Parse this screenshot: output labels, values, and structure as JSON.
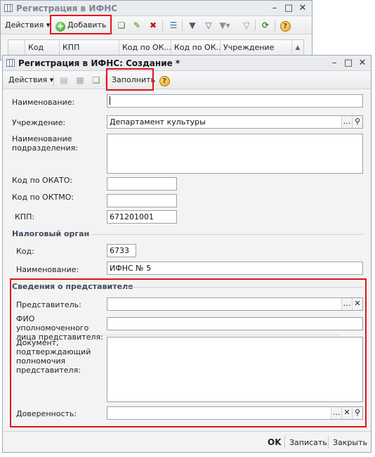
{
  "back_window": {
    "title": "Регистрация в ИФНС",
    "toolbar": {
      "actions_label": "Действия",
      "add_label": "Добавить"
    },
    "columns": [
      "Код",
      "КПП",
      "Код по ОК...",
      "Код по ОК...",
      "Учреждение"
    ]
  },
  "front_window": {
    "title": "Регистрация в ИФНС: Создание *",
    "toolbar": {
      "actions_label": "Действия",
      "fill_label": "Заполнить"
    },
    "fields": {
      "name_label": "Наименование:",
      "name_value": "",
      "institution_label": "Учреждение:",
      "institution_value": "Департамент культуры",
      "subdivision_label": "Наименование подразделения:",
      "okato_label": "Код по ОКАТО:",
      "oktmo_label": "Код по ОКТМО:",
      "kpp_label": "КПП:",
      "kpp_value": "671201001"
    },
    "tax_authority": {
      "group_label": "Налоговый орган",
      "code_label": "Код:",
      "code_value": "6733",
      "name_label": "Наименование:",
      "name_value": "ИФНС № 5"
    },
    "representative": {
      "group_label": "Сведения о представителе",
      "rep_label": "Представитель:",
      "fio_label": "ФИО уполномоченного лица представителя:",
      "document_label": "Документ, подтверждающий полномочия представителя:",
      "poa_label": "Доверенность:"
    },
    "footer": {
      "ok_label": "OK",
      "save_label": "Записать",
      "close_label": "Закрыть"
    }
  },
  "colors": {
    "highlight": "#e3121a",
    "group_text": "#404a5c"
  }
}
